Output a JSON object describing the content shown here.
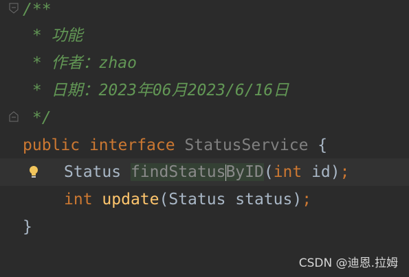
{
  "colors": {
    "background": "#2b2b2b",
    "current_line": "#323232",
    "doc_comment": "#629755",
    "keyword": "#cc7832",
    "method": "#ffc66d",
    "default_text": "#a9b7c6",
    "unused_highlight": "#344134"
  },
  "icons": {
    "fold_top": "fold-arrow-icon",
    "fold_bottom": "fold-arrow-icon",
    "intention": "lightbulb-icon"
  },
  "code": {
    "doc_open": "/**",
    "doc_line1": " * 功能",
    "doc_line2": " * 作者：zhao",
    "doc_line3": " * 日期：2023年06月2023/6/16日",
    "doc_close": " */",
    "decl": {
      "public": "public",
      "interface": "interface",
      "name": "StatusService",
      "brace_open": " {"
    },
    "method1": {
      "return_type": "Status",
      "name_part1": "findStatus",
      "name_part2": "ByID",
      "paren_open": "(",
      "param_type": "int",
      "param_rest": " id)",
      "semi": ";"
    },
    "method2": {
      "return_type": "int",
      "name": "update",
      "params": "(Status status)",
      "semi": ";"
    },
    "brace_close": "}"
  },
  "watermark": "CSDN @迪恩.拉姆"
}
